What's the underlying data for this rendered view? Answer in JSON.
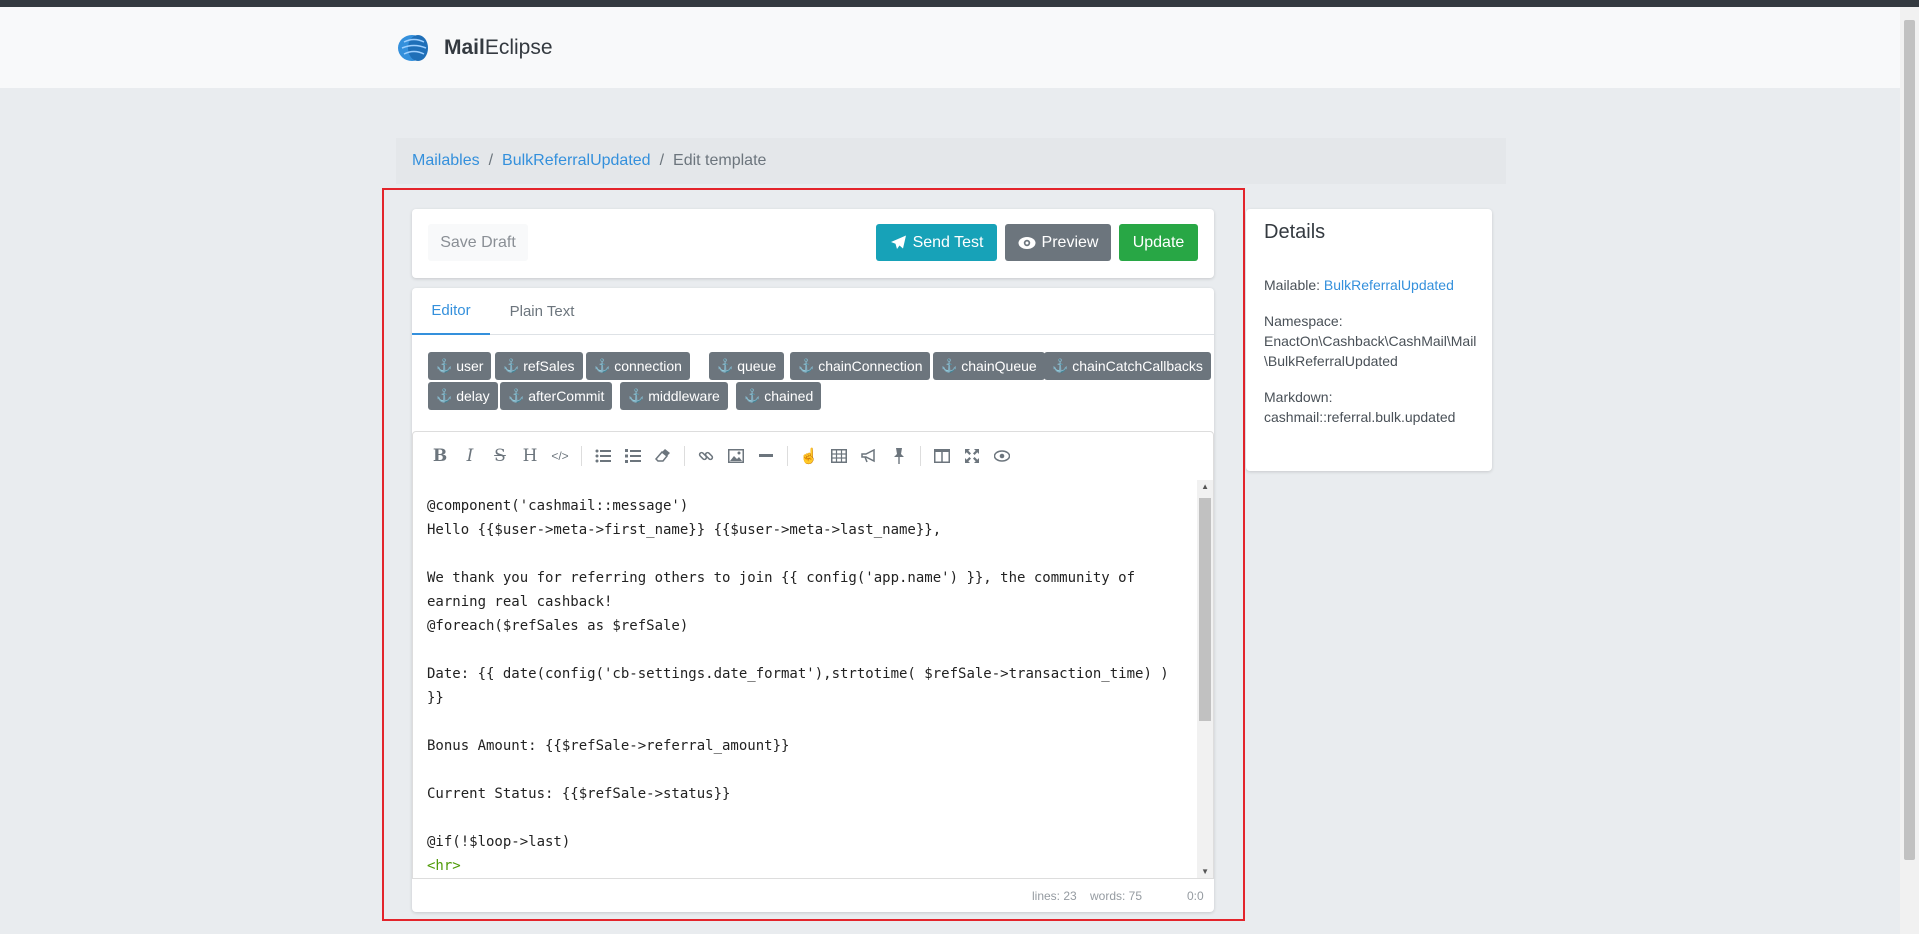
{
  "brand": {
    "bold": "Mail",
    "rest": "Eclipse"
  },
  "breadcrumb": {
    "item1": "Mailables",
    "item2": "BulkReferralUpdated",
    "current": "Edit template",
    "separator": "/"
  },
  "actions": {
    "save_draft": "Save Draft",
    "send_test": "Send Test",
    "preview": "Preview",
    "update": "Update"
  },
  "tabs": {
    "editor": "Editor",
    "plain_text": "Plain Text"
  },
  "variables": [
    "user",
    "refSales",
    "connection",
    "queue",
    "chainConnection",
    "chainQueue",
    "chainCatchCallbacks",
    "delay",
    "afterCommit",
    "middleware",
    "chained"
  ],
  "code": [
    "@component('cashmail::message')",
    "Hello {{$user->meta->first_name}} {{$user->meta->last_name}},",
    "",
    "We thank you for referring others to join {{ config('app.name') }}, the community of earning real cashback!",
    "@foreach($refSales as $refSale)",
    "",
    "Date: {{ date(config('cb-settings.date_format'),strtotime( $refSale->transaction_time) ) }}",
    "",
    "Bonus Amount: {{$refSale->referral_amount}}",
    "",
    "Current Status: {{$refSale->status}}",
    "",
    "@if(!$loop->last)",
    "<hr>"
  ],
  "status": {
    "lines": "lines: 23",
    "words": "words: 75",
    "cursor": "0:0"
  },
  "details": {
    "title": "Details",
    "mailable_label": "Mailable:",
    "mailable_value": "BulkReferralUpdated",
    "namespace_label": "Namespace:",
    "namespace_value": "EnactOn\\Cashback\\CashMail\\Mail\\BulkReferralUpdated",
    "markdown_label": "Markdown:",
    "markdown_value": "cashmail::referral.bulk.updated"
  },
  "colors": {
    "primary": "#3490dc",
    "info": "#17a2b8",
    "secondary": "#6c757d",
    "success": "#28a745",
    "highlight": "#e3242b"
  }
}
